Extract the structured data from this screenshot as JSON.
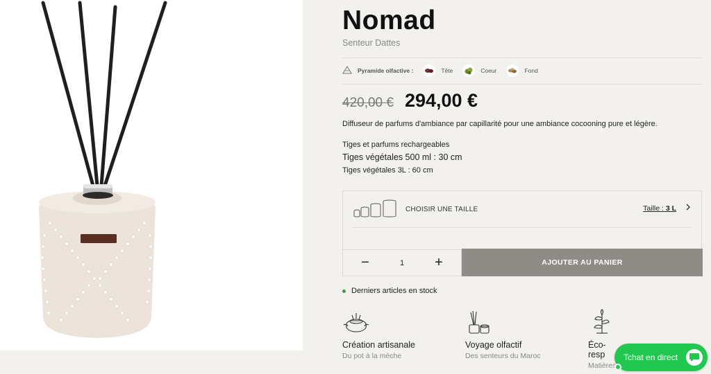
{
  "product": {
    "title": "Nomad",
    "subtitle": "Senteur Dattes",
    "image_alt": "reed-diffuser-photo"
  },
  "pyramid": {
    "label": "Pyramide olfactive :",
    "notes": [
      {
        "name": "Tête",
        "icon": "dates-icon",
        "color": "#7a2d35"
      },
      {
        "name": "Coeur",
        "icon": "herb-icon",
        "color": "#6c8a2a"
      },
      {
        "name": "Fond",
        "icon": "nuts-icon",
        "color": "#b58a5a"
      }
    ]
  },
  "price": {
    "old": "420,00 €",
    "current": "294,00 €"
  },
  "description": "Diffuseur de parfums d'ambiance par capillarité pour une ambiance cocooning pure et légère.",
  "specs": {
    "line1": "Tiges et parfums rechargeables",
    "line2": "Tiges végétales 500 ml : 30 cm",
    "line3": "Tiges végétales 3L : 60 cm"
  },
  "size": {
    "label": "CHOISIR UNE TAILLE",
    "value_prefix": "Taille : ",
    "value": "3 L"
  },
  "cart": {
    "quantity": "1",
    "minus": "−",
    "plus": "+",
    "add_label": "AJOUTER AU PANIER"
  },
  "stock": {
    "text": "Derniers articles en stock",
    "color": "#33a34a"
  },
  "features": [
    {
      "title": "Création artisanale",
      "subtitle": "Du pot à la mèche",
      "icon": "craft-hands-icon"
    },
    {
      "title": "Voyage olfactif",
      "subtitle": "Des senteurs du Maroc",
      "icon": "diffuser-icon"
    },
    {
      "title": "Éco-resp",
      "subtitle": "Matières",
      "icon": "plant-icon"
    }
  ],
  "chat": {
    "label": "Tchat en direct",
    "color": "#21c74e"
  }
}
